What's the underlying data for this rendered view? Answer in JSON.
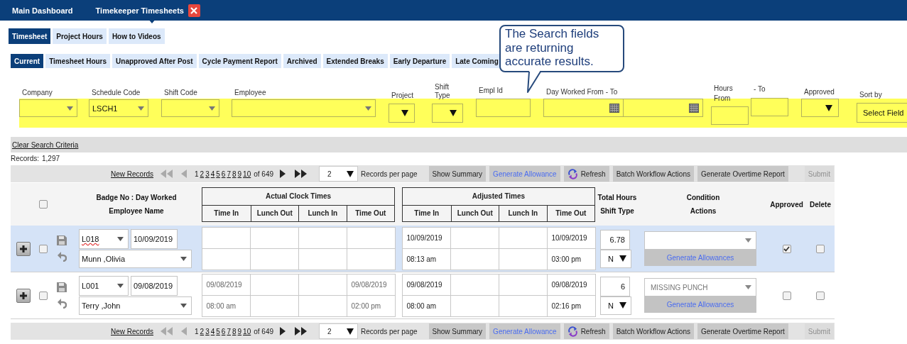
{
  "top_tabs": [
    {
      "label": "Main Dashboard",
      "selected": false,
      "closable": false
    },
    {
      "label": "Timekeeper Timesheets",
      "selected": true,
      "closable": true
    }
  ],
  "tabs": [
    {
      "label": "Timesheet",
      "selected": true
    },
    {
      "label": "Project Hours",
      "selected": false
    },
    {
      "label": "How to Videos",
      "selected": false
    }
  ],
  "subtabs": [
    {
      "label": "Current",
      "selected": true
    },
    {
      "label": "Timesheet Hours",
      "selected": false
    },
    {
      "label": "Unapproved After Post",
      "selected": false
    },
    {
      "label": "Cycle Payment Report",
      "selected": false
    },
    {
      "label": "Archived",
      "selected": false
    },
    {
      "label": "Extended Breaks",
      "selected": false
    },
    {
      "label": "Early Departure",
      "selected": false
    },
    {
      "label": "Late Coming",
      "selected": false
    }
  ],
  "callout": "The Search fields are returning accurate results.",
  "filters": [
    {
      "label": "Company",
      "kind": "select"
    },
    {
      "label": "Schedule Code",
      "kind": "select",
      "value": "LSCH1"
    },
    {
      "label": "Shift Code",
      "kind": "select"
    },
    {
      "label": "Employee",
      "kind": "select"
    },
    {
      "label": "Project",
      "kind": "dropdown"
    },
    {
      "label": "Shift Type",
      "kind": "dropdown"
    },
    {
      "label": "Empl Id",
      "kind": "text"
    },
    {
      "label": "Day Worked From - To",
      "kind": "date-range"
    },
    {
      "label": "Hours From",
      "kind": "text"
    },
    {
      "label": "- To",
      "kind": "text"
    },
    {
      "label": "Approved",
      "kind": "dropdown"
    },
    {
      "label": "Sort by",
      "kind": "sort",
      "value": "Select Field"
    }
  ],
  "clear_link": "Clear Search Criteria",
  "records": {
    "label": "Records:",
    "count": "1,297"
  },
  "pager_top": {
    "new_records": "New Records",
    "nav": [
      {
        "kind": "first",
        "disabled": true
      },
      {
        "kind": "prev",
        "disabled": true
      },
      {
        "kind": "next",
        "disabled": false
      },
      {
        "kind": "last",
        "disabled": false
      }
    ],
    "pages": [
      {
        "label": "1",
        "selected": true
      },
      {
        "label": "2",
        "selected": false
      },
      {
        "label": "3",
        "selected": false
      },
      {
        "label": "4",
        "selected": false
      },
      {
        "label": "5",
        "selected": false
      },
      {
        "label": "6",
        "selected": false
      },
      {
        "label": "7",
        "selected": false
      },
      {
        "label": "8",
        "selected": false
      },
      {
        "label": "9",
        "selected": false
      },
      {
        "label": "10",
        "selected": false
      }
    ],
    "total": "of 649",
    "per_page": "2",
    "per_page_label": "Records per page",
    "buttons": [
      {
        "label": "Show Summary",
        "kind": "plain",
        "disabled": false
      },
      {
        "label": "Generate Allowance",
        "kind": "link",
        "disabled": false
      },
      {
        "label": "Refresh",
        "kind": "refresh",
        "disabled": false
      },
      {
        "label": "Batch Workflow Actions",
        "kind": "plain",
        "disabled": false
      },
      {
        "label": "Generate Overtime Report",
        "kind": "plain",
        "disabled": false
      },
      {
        "label": "Submit",
        "kind": "plain",
        "disabled": true
      }
    ]
  },
  "table": {
    "select_all": {
      "checked": false
    },
    "badge_header": [
      "Badge No : Day Worked",
      "Employee Name"
    ],
    "groups": [
      {
        "title": "Actual Clock Times",
        "columns": [
          "Time In",
          "Lunch Out",
          "Lunch In",
          "Time Out"
        ]
      },
      {
        "title": "Adjusted Times",
        "columns": [
          "Time In",
          "Lunch Out",
          "Lunch In",
          "Time Out"
        ]
      }
    ],
    "hours_header": [
      "Total Hours",
      "Shift Type"
    ],
    "condition_header": [
      "Condition",
      "Actions"
    ],
    "approved_header": "Approved",
    "delete_header": "Delete",
    "rows": [
      {
        "selected": true,
        "checked": false,
        "badge": "L018",
        "badge_flagged": true,
        "date": "10/09/2019",
        "employee": "Munn ,Olivia",
        "adjusted": {
          "time_in": {
            "date": "10/09/2019",
            "time": "08:13 am"
          },
          "time_out": {
            "date": "10/09/2019",
            "time": "03:00 pm"
          }
        },
        "total_hours": "6.78",
        "shift_type": "N",
        "action": "Generate Allowances",
        "approved": true,
        "delete": false
      },
      {
        "selected": false,
        "checked": false,
        "badge": "L001",
        "badge_flagged": false,
        "date": "09/08/2019",
        "employee": "Terry ,John",
        "actual": {
          "time_in": {
            "date": "09/08/2019",
            "time": "08:00 am"
          },
          "time_out": {
            "date": "09/08/2019",
            "time": "02:00 pm"
          }
        },
        "adjusted": {
          "time_in": {
            "date": "09/08/2019",
            "time": "08:00 am"
          },
          "time_out": {
            "date": "09/08/2019",
            "time": "02:16 pm"
          }
        },
        "total_hours": "6",
        "shift_type": "N",
        "condition": "MISSING PUNCH",
        "action": "Generate Allowances",
        "approved": false,
        "delete": false
      }
    ]
  },
  "pager_bottom": {
    "new_records": "New Records",
    "nav": [
      {
        "kind": "first",
        "disabled": true
      },
      {
        "kind": "prev",
        "disabled": true
      },
      {
        "kind": "next",
        "disabled": false
      },
      {
        "kind": "last",
        "disabled": false
      }
    ],
    "pages": [
      {
        "label": "1",
        "selected": true
      },
      {
        "label": "2",
        "selected": false
      },
      {
        "label": "3",
        "selected": false
      },
      {
        "label": "4",
        "selected": false
      },
      {
        "label": "5",
        "selected": false
      },
      {
        "label": "6",
        "selected": false
      },
      {
        "label": "7",
        "selected": false
      },
      {
        "label": "8",
        "selected": false
      },
      {
        "label": "9",
        "selected": false
      },
      {
        "label": "10",
        "selected": false
      }
    ],
    "total": "of 649",
    "per_page": "2",
    "per_page_label": "Records per page",
    "buttons": [
      {
        "label": "Show Summary",
        "kind": "plain",
        "disabled": false
      },
      {
        "label": "Generate Allowance",
        "kind": "link",
        "disabled": false
      },
      {
        "label": "Refresh",
        "kind": "refresh",
        "disabled": false
      },
      {
        "label": "Batch Workflow Actions",
        "kind": "plain",
        "disabled": false
      },
      {
        "label": "Generate Overtime Report",
        "kind": "plain",
        "disabled": false
      },
      {
        "label": "Submit",
        "kind": "plain",
        "disabled": true
      }
    ]
  }
}
